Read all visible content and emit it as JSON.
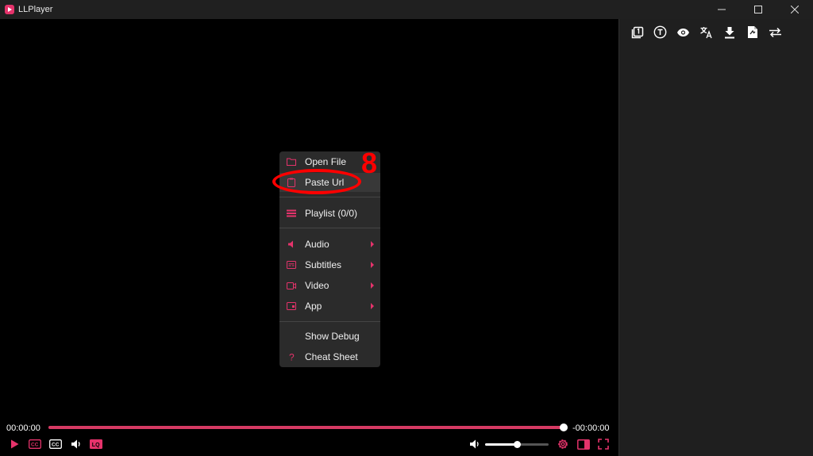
{
  "window": {
    "title": "LLPlayer",
    "controls": {
      "minimize_icon": "minimize-icon",
      "maximize_icon": "maximize-icon",
      "close_icon": "close-icon"
    }
  },
  "side_panel": {
    "toolbar": [
      "subtitle-1-icon",
      "text-icon",
      "eye-icon",
      "translate-icon",
      "download-icon",
      "document-icon",
      "swap-icon"
    ]
  },
  "context_menu": {
    "items": [
      {
        "label": "Open File",
        "icon": "folder-icon"
      },
      {
        "label": "Paste Url",
        "icon": "clipboard-icon"
      },
      {
        "label": "Playlist (0/0)",
        "icon": "list-icon"
      },
      {
        "label": "Audio",
        "icon": "speaker-icon",
        "submenu": true
      },
      {
        "label": "Subtitles",
        "icon": "subtitles-icon",
        "submenu": true
      },
      {
        "label": "Video",
        "icon": "video-icon",
        "submenu": true
      },
      {
        "label": "App",
        "icon": "app-icon",
        "submenu": true
      },
      {
        "label": "Show Debug"
      },
      {
        "label": "Cheat Sheet",
        "icon": "help-icon"
      }
    ]
  },
  "annotation": {
    "number": "8"
  },
  "player": {
    "time_current": "00:00:00",
    "time_remaining": "-00:00:00",
    "seek_progress": 1.0,
    "volume_level": 0.5,
    "lq_label": "LQ",
    "cc_label": "CC"
  },
  "colors": {
    "accent": "#e5336b",
    "menu_bg": "#2b2b2b",
    "panel_bg": "#1f1f1f",
    "annotation": "#ff0000"
  }
}
